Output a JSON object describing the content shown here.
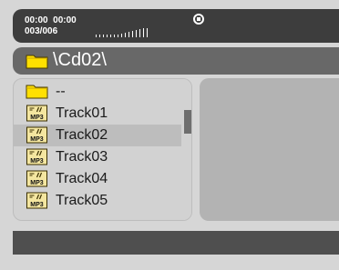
{
  "status": {
    "elapsed": "00:00",
    "total": "00:00",
    "track_counter": "003/006",
    "level_bars": [
      3,
      3,
      3,
      3,
      3,
      3,
      3,
      4,
      5,
      6,
      7,
      8,
      9,
      10,
      10
    ]
  },
  "path": {
    "text": "\\Cd02\\"
  },
  "file_list": {
    "items": [
      {
        "label": "--",
        "icon": "folder-icon"
      },
      {
        "label": "Track01",
        "icon": "mp3-file-icon"
      },
      {
        "label": "Track02",
        "icon": "mp3-file-icon",
        "selected": true
      },
      {
        "label": "Track03",
        "icon": "mp3-file-icon"
      },
      {
        "label": "Track04",
        "icon": "mp3-file-icon"
      },
      {
        "label": "Track05",
        "icon": "mp3-file-icon"
      }
    ]
  },
  "colors": {
    "folder": "#ffe000",
    "status_bar": "#3d3d3d",
    "path_bar": "#686868",
    "selection": "#bdbdbd"
  }
}
